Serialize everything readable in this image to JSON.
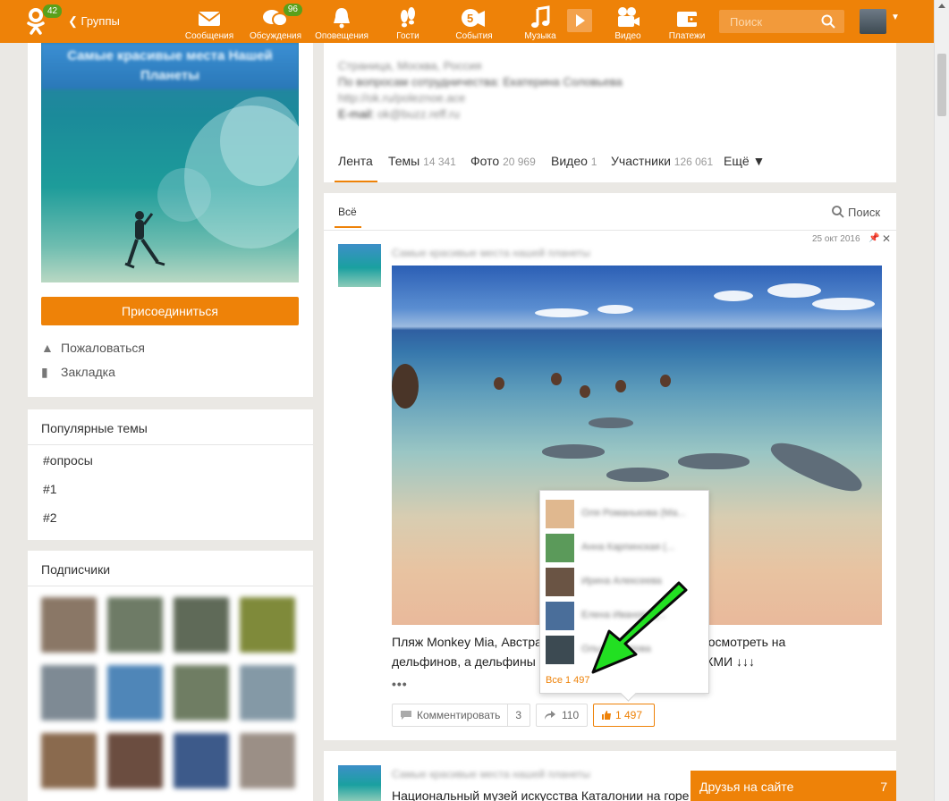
{
  "header": {
    "logo_badge": "42",
    "groups_link": "Группы",
    "nav": [
      {
        "label": "Сообщения",
        "icon": "envelope-icon"
      },
      {
        "label": "Обсуждения",
        "icon": "chat-bubbles-icon",
        "badge": "96"
      },
      {
        "label": "Оповещения",
        "icon": "bell-icon"
      },
      {
        "label": "Гости",
        "icon": "footprints-icon"
      },
      {
        "label": "События",
        "icon": "events-icon"
      },
      {
        "label": "Музыка",
        "icon": "music-note-icon"
      },
      {
        "label": "Видео",
        "icon": "video-camera-icon"
      },
      {
        "label": "Платежи",
        "icon": "wallet-icon"
      }
    ],
    "search_placeholder": "Поиск"
  },
  "left": {
    "cover_title": "Самые красивые места Нашей Планеты",
    "join_label": "Присоединиться",
    "complain_label": "Пожаловаться",
    "bookmark_label": "Закладка",
    "popular_title": "Популярные темы",
    "tags": [
      "#опросы",
      "#1",
      "#2"
    ],
    "subscribers_title": "Подписчики"
  },
  "group_info": {
    "line1": "Страница, Москва, Россия",
    "line2": "По вопросам сотрудничества: Екатерина Соловьева",
    "line3": "http://ok.ru/poleznoe.ace",
    "line4_label": "E-mail:",
    "line4_value": "ok@buzz.reff.ru"
  },
  "tabs": [
    {
      "label": "Лента",
      "count": ""
    },
    {
      "label": "Темы",
      "count": "14 341"
    },
    {
      "label": "Фото",
      "count": "20 969"
    },
    {
      "label": "Видео",
      "count": "1"
    },
    {
      "label": "Участники",
      "count": "126 061"
    },
    {
      "label": "Ещё ▼",
      "count": ""
    }
  ],
  "feed": {
    "filter_all": "Всё",
    "search_label": "Поиск"
  },
  "post": {
    "group_name": "Самые красивые места нашей планеты",
    "date": "25 окт 2016",
    "text_line1": "Пляж Monkey Mia, Австра                                    люди посмотреть на",
    "text_line2": "дельфинов, а дельфины                                    юдей!  ЖМИ ↓↓↓",
    "more": "•••",
    "comment_label": "Комментировать",
    "comment_count": "3",
    "share_count": "110",
    "like_count": "1 497"
  },
  "likers_popup": {
    "likers": [
      "Оля Романькова (Ма...",
      "Анна Карпинская (...",
      "Ирина Алексеева",
      "Елена Иванова (...",
      "Ольга Осипова"
    ],
    "all_label": "Все 1 497"
  },
  "second_post": {
    "group_name": "Самые красивые места нашей планеты",
    "text": "Национальный музей искусства Каталонии на горе"
  },
  "friends_online": {
    "label": "Друзья на сайте",
    "count": "7"
  },
  "colors": {
    "brand_orange": "#ee8208",
    "badge_green": "#5aa01a",
    "arrow_green": "#22e022"
  }
}
